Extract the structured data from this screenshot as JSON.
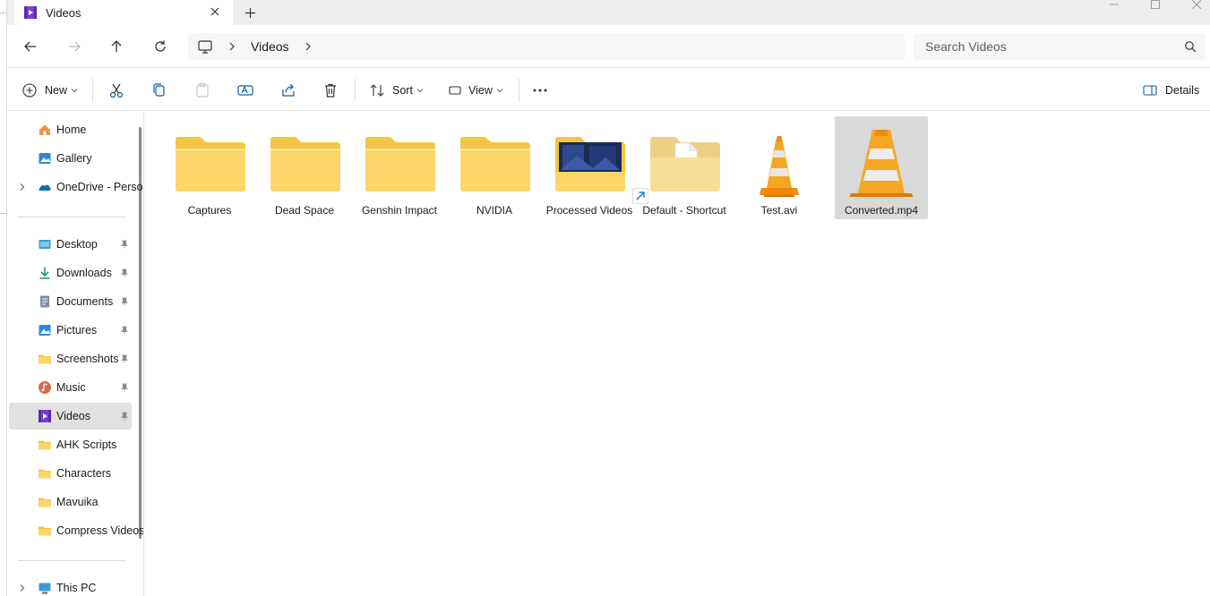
{
  "window": {
    "tab_title": "Videos",
    "new_tab_symbol": "+"
  },
  "navigation": {
    "back": "arrow-left-icon",
    "forward": "arrow-right-icon",
    "up": "arrow-up-icon",
    "refresh": "refresh-icon",
    "breadcrumb": [
      "Videos"
    ],
    "search_placeholder": "Search Videos"
  },
  "toolbar": {
    "new_label": "New",
    "sort_label": "Sort",
    "view_label": "View",
    "details_label": "Details",
    "more_symbol": "•••"
  },
  "sidebar": {
    "top_items": [
      {
        "label": "Home",
        "icon": "home-icon"
      },
      {
        "label": "Gallery",
        "icon": "gallery-icon"
      },
      {
        "label": "OneDrive - Personal",
        "icon": "onedrive-icon"
      }
    ],
    "quick_access": [
      {
        "label": "Desktop",
        "icon": "desktop-icon",
        "pinned": true
      },
      {
        "label": "Downloads",
        "icon": "downloads-icon",
        "pinned": true
      },
      {
        "label": "Documents",
        "icon": "documents-icon",
        "pinned": true
      },
      {
        "label": "Pictures",
        "icon": "pictures-icon",
        "pinned": true
      },
      {
        "label": "Screenshots",
        "icon": "folder-icon",
        "pinned": true
      },
      {
        "label": "Music",
        "icon": "music-icon",
        "pinned": true
      },
      {
        "label": "Videos",
        "icon": "videos-icon",
        "pinned": true,
        "active": true
      },
      {
        "label": "AHK Scripts",
        "icon": "folder-icon"
      },
      {
        "label": "Characters",
        "icon": "folder-icon"
      },
      {
        "label": "Mavuika",
        "icon": "folder-icon"
      },
      {
        "label": "Compress Videos",
        "icon": "folder-icon"
      }
    ],
    "bottom_items": [
      {
        "label": "This PC",
        "icon": "this-pc-icon"
      }
    ]
  },
  "files": [
    {
      "name": "Captures",
      "type": "folder"
    },
    {
      "name": "Dead Space",
      "type": "folder"
    },
    {
      "name": "Genshin Impact",
      "type": "folder"
    },
    {
      "name": "NVIDIA",
      "type": "folder"
    },
    {
      "name": "Processed Videos",
      "type": "folder-with-preview"
    },
    {
      "name": "Default - Shortcut",
      "type": "shortcut"
    },
    {
      "name": "Test.avi",
      "type": "vlc-video"
    },
    {
      "name": "Converted.mp4",
      "type": "vlc-video",
      "selected": true
    }
  ],
  "colors": {
    "folder_back": "#f4c542",
    "folder_front": "#fcd66b",
    "accent": "#0067c0",
    "selected_bg": "#d9d9d9",
    "vlc_orange": "#f08a0f"
  }
}
